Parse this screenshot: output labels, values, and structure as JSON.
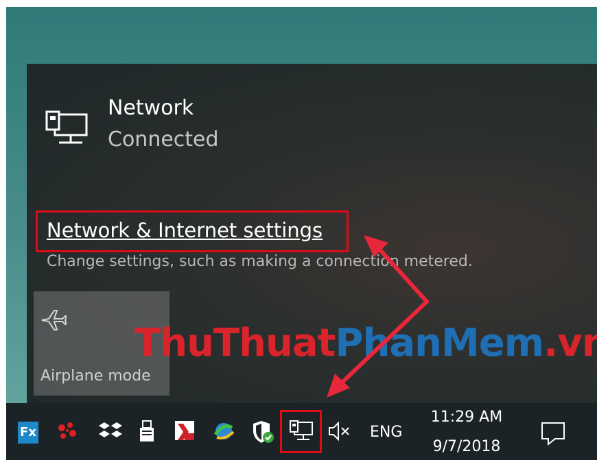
{
  "network": {
    "name": "Network",
    "status": "Connected",
    "icon": "wired-network-icon"
  },
  "settings": {
    "link": "Network & Internet settings",
    "description": "Change settings, such as making a connection metered."
  },
  "quick_actions": {
    "airplane_label": "Airplane mode",
    "airplane_icon": "airplane-icon"
  },
  "watermark": {
    "part1": "ThuThuat",
    "part2": "PhanMem",
    "part3": ".vn"
  },
  "taskbar": {
    "fx_label": "Fx",
    "language": "ENG",
    "time": "11:29 AM",
    "date": "9/7/2018",
    "icons": [
      "fx-app-icon",
      "apps-cluster-icon",
      "dropbox-icon",
      "usb-device-icon",
      "kaspersky-icon",
      "browser-icon",
      "defender-shield-icon",
      "network-icon",
      "volume-muted-icon",
      "action-center-icon"
    ]
  },
  "colors": {
    "highlight": "#e00b16",
    "watermark_red": "#d9242b",
    "watermark_blue": "#1e6fb3"
  }
}
